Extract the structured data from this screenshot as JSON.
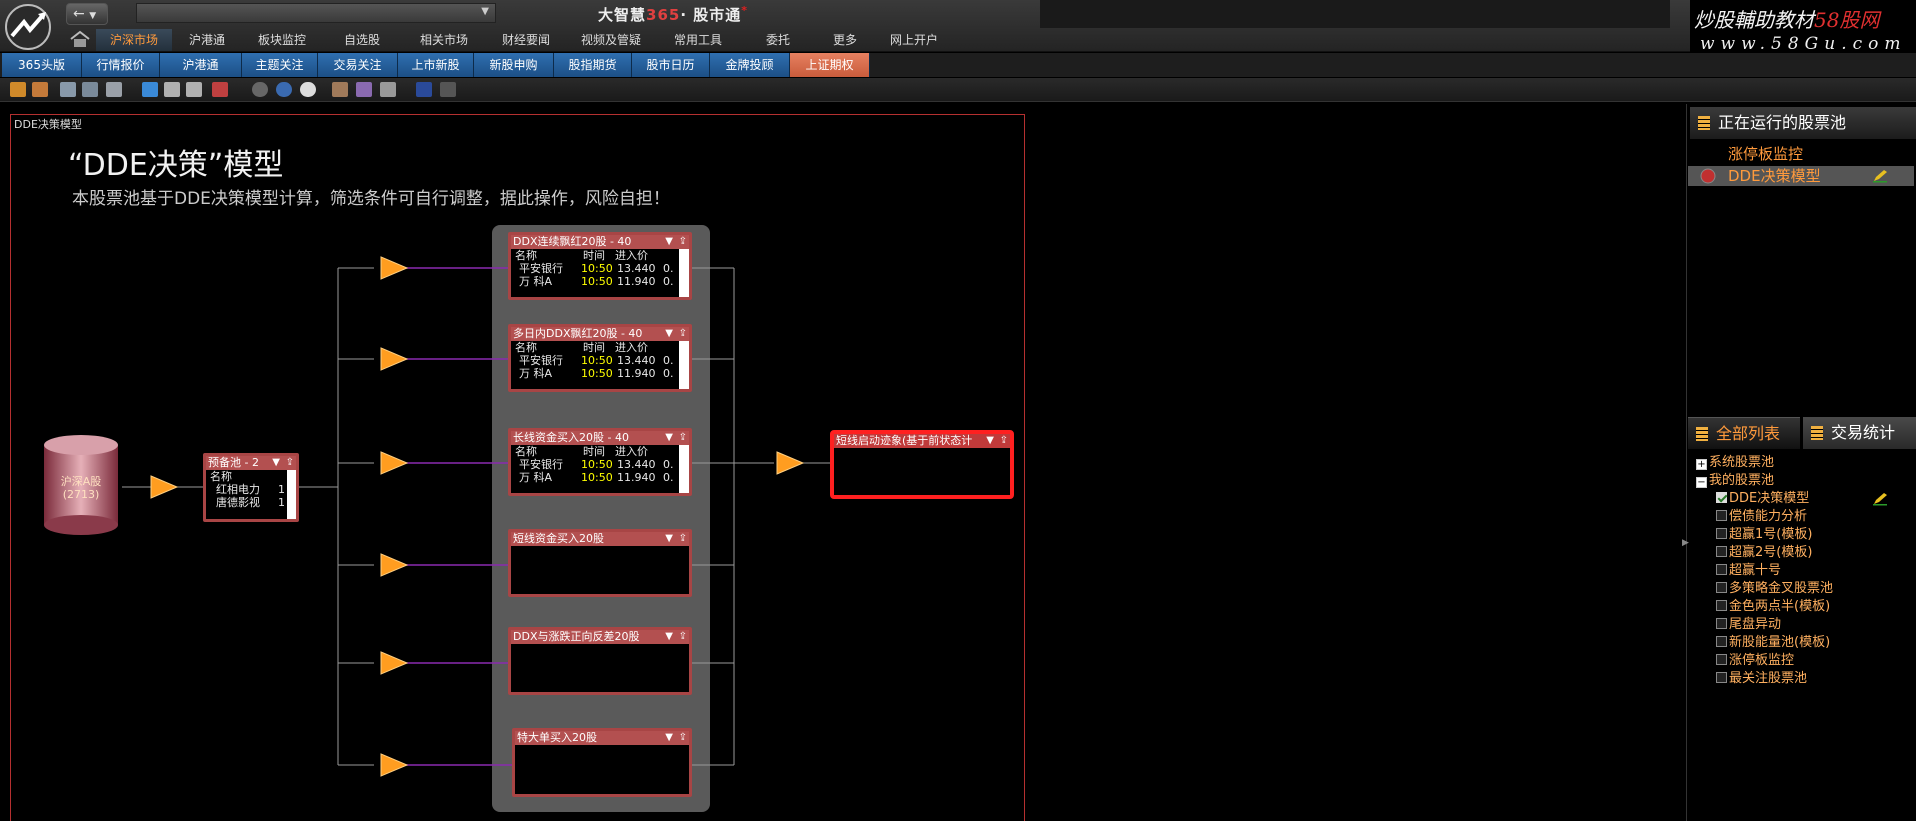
{
  "app": {
    "title_main": "大智慧",
    "title_365": "365",
    "title_dot": "·",
    "title_sub": "股市通",
    "title_mark": "*"
  },
  "brand": {
    "line1_a": "炒股輔助教材",
    "line1_b": "58股网",
    "line2": "www.58Gu.com"
  },
  "nav": {
    "back": "←",
    "address": "",
    "menu": [
      {
        "label": "沪深市场",
        "active": true
      },
      {
        "label": "沪港通",
        "active": false
      },
      {
        "label": "板块监控",
        "active": false
      },
      {
        "label": "自选股",
        "active": false
      },
      {
        "label": "相关市场",
        "active": false
      },
      {
        "label": "财经要闻",
        "active": false
      },
      {
        "label": "视频及管疑",
        "active": false
      },
      {
        "label": "常用工具",
        "active": false
      },
      {
        "label": "委托",
        "active": false
      },
      {
        "label": "更多",
        "active": false
      },
      {
        "label": "网上开户",
        "active": false
      }
    ]
  },
  "tabs": [
    {
      "label": "365头版",
      "active": false
    },
    {
      "label": "行情报价",
      "active": false
    },
    {
      "label": "沪港通",
      "active": false
    },
    {
      "label": "主题关注",
      "active": false
    },
    {
      "label": "交易关注",
      "active": false
    },
    {
      "label": "上市新股",
      "active": false
    },
    {
      "label": "新股申购",
      "active": false
    },
    {
      "label": "股指期货",
      "active": false
    },
    {
      "label": "股市日历",
      "active": false
    },
    {
      "label": "金牌投顾",
      "active": false
    },
    {
      "label": "上证期权",
      "active": true
    }
  ],
  "canvas": {
    "window_title": "DDE决策模型",
    "model_title": "“DDE决策”模型",
    "model_desc": "本股票池基于DDE决策模型计算，筛选条件可自行调整，据此操作，风险自担！",
    "source": {
      "name": "沪深A股",
      "count": "(2713)"
    },
    "pre_pool": {
      "title": "预备池 - 2",
      "col": "名称",
      "rows": [
        {
          "name": "红相电力",
          "v": "1"
        },
        {
          "name": "唐德影视",
          "v": "1"
        }
      ]
    },
    "filters": [
      {
        "title": "DDX连续飘红20股 - 40",
        "cols": [
          "名称",
          "时间",
          "进入价"
        ],
        "rows": [
          {
            "name": "平安银行",
            "time": "10:50",
            "price": "13.440",
            "extra": "0."
          },
          {
            "name": "万  科A",
            "time": "10:50",
            "price": "11.940",
            "extra": "0."
          }
        ]
      },
      {
        "title": "多日内DDX飘红20股 - 40",
        "cols": [
          "名称",
          "时间",
          "进入价"
        ],
        "rows": [
          {
            "name": "平安银行",
            "time": "10:50",
            "price": "13.440",
            "extra": "0."
          },
          {
            "name": "万  科A",
            "time": "10:50",
            "price": "11.940",
            "extra": "0."
          }
        ]
      },
      {
        "title": "长线资金买入20股 - 40",
        "cols": [
          "名称",
          "时间",
          "进入价"
        ],
        "rows": [
          {
            "name": "平安银行",
            "time": "10:50",
            "price": "13.440",
            "extra": "0."
          },
          {
            "name": "万  科A",
            "time": "10:50",
            "price": "11.940",
            "extra": "0."
          }
        ]
      },
      {
        "title": "短线资金买入20股"
      },
      {
        "title": "DDX与涨跌正向反差20股"
      },
      {
        "title": "特大单买入20股"
      }
    ],
    "output": {
      "title": "短线启动迹象(基于前状态计"
    }
  },
  "right": {
    "running_header": "正在运行的股票池",
    "running_items": [
      {
        "label": "涨停板监控"
      },
      {
        "label": "DDE决策模型"
      }
    ],
    "tab_all": "全部列表",
    "tab_stats": "交易统计",
    "tree": {
      "system": "系统股票池",
      "mine": "我的股票池",
      "items": [
        {
          "label": "DDE决策模型",
          "checked": true
        },
        {
          "label": "偿债能力分析",
          "checked": false
        },
        {
          "label": "超赢1号(模板)",
          "checked": false
        },
        {
          "label": "超赢2号(模板)",
          "checked": false
        },
        {
          "label": "超赢十号",
          "checked": false
        },
        {
          "label": "多策略金叉股票池",
          "checked": false
        },
        {
          "label": "金色两点半(模板)",
          "checked": false
        },
        {
          "label": "尾盘异动",
          "checked": false
        },
        {
          "label": "新股能量池(模板)",
          "checked": false
        },
        {
          "label": "涨停板监控",
          "checked": false
        },
        {
          "label": "最关注股票池",
          "checked": false
        }
      ]
    }
  },
  "colors": {
    "accent": "#ff9a3c",
    "tab_blue": "#2f6fb0",
    "tab_active": "#e68060",
    "node_border": "#a84545",
    "output_border": "#ff2020",
    "flow_line": "#8a2ab0",
    "flow_arrow": "#ff9d20"
  }
}
